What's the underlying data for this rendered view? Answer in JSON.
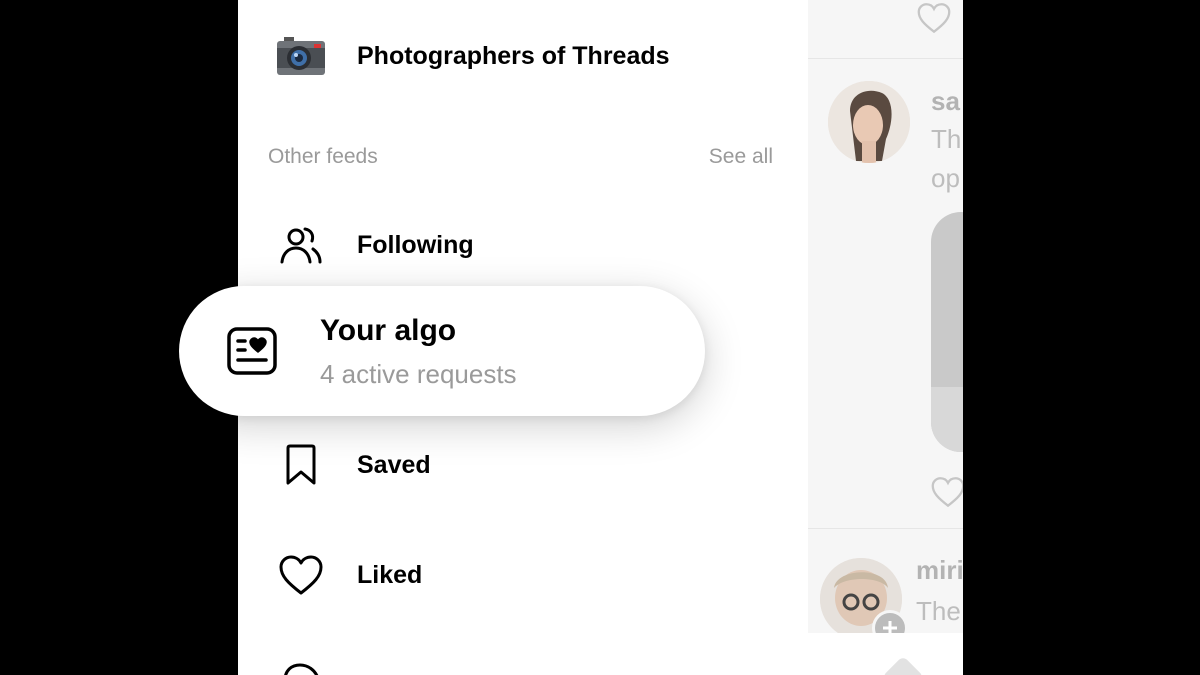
{
  "drawer": {
    "top_feed": {
      "label": "Photographers of Threads",
      "icon": "camera-icon"
    },
    "section": {
      "title": "Other feeds",
      "action": "See all"
    },
    "items": [
      {
        "label": "Following",
        "icon": "people-icon"
      },
      {
        "label": "Saved",
        "icon": "bookmark-icon"
      },
      {
        "label": "Liked",
        "icon": "heart-icon"
      }
    ],
    "highlight": {
      "title": "Your algo",
      "subtitle": "4 active requests",
      "icon": "algo-card-heart-icon"
    }
  },
  "feed_peek": {
    "posts": [
      {
        "name_fragment": "sa",
        "text_fragments": [
          "Th",
          "op"
        ]
      },
      {
        "name_fragment": "miri",
        "text_fragments": [
          "The"
        ]
      }
    ]
  },
  "colors": {
    "muted_text": "#9a9a9a",
    "primary_text": "#000000",
    "background": "#ffffff",
    "letterbox": "#000000"
  }
}
